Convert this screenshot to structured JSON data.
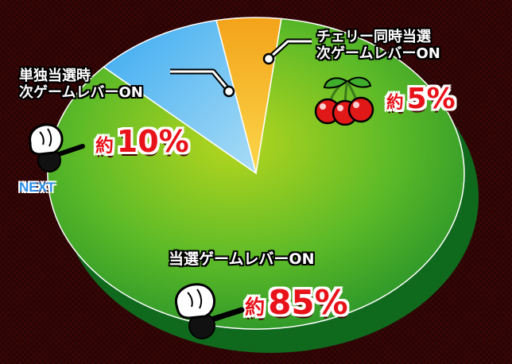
{
  "chart_data": {
    "type": "pie",
    "slices": [
      {
        "label": "当選ゲームレバーON",
        "value": 85,
        "display": "85%",
        "prefix": "約",
        "color": "#2fa52a"
      },
      {
        "label": "単独当選時\n次ゲームレバーON",
        "value": 10,
        "display": "10%",
        "prefix": "約",
        "color": "#2a9be0"
      },
      {
        "label": "チェリー同時当選\n次ゲームレバーON",
        "value": 5,
        "display": "5%",
        "prefix": "約",
        "color": "#f0a51a"
      }
    ],
    "start_angle_deg": -11,
    "direction": "clockwise",
    "annotations": {
      "next": "NEXT"
    }
  },
  "colors": {
    "background": "#3a0606",
    "percent_text": "#e8121a",
    "next_text": "#2a8fe8"
  },
  "icons": [
    "lever-hand-icon",
    "cherry-icon"
  ]
}
